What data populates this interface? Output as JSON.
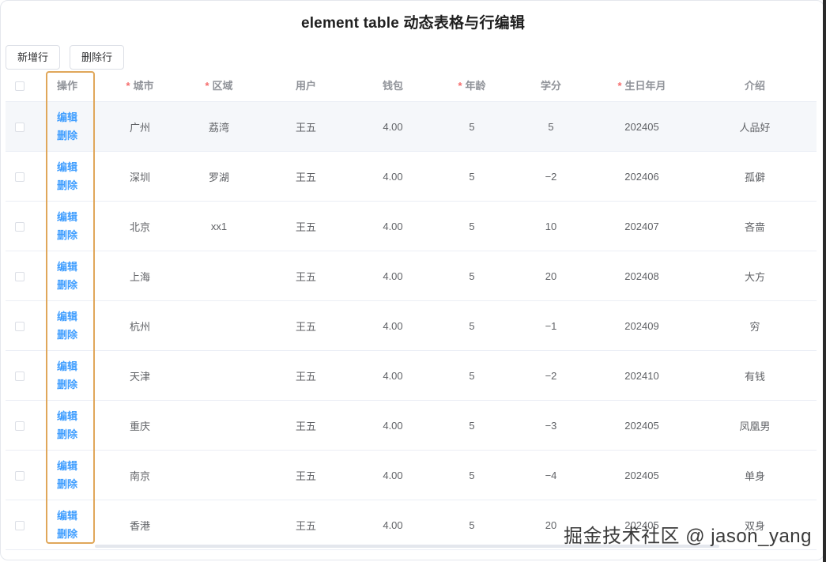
{
  "title": "element table 动态表格与行编辑",
  "toolbar": {
    "add_label": "新增行",
    "delete_label": "删除行"
  },
  "columns": {
    "op": "操作",
    "city": "城市",
    "area": "区域",
    "user": "用户",
    "wallet": "钱包",
    "age": "年龄",
    "credit": "学分",
    "birth": "生日年月",
    "intro": "介绍",
    "required_mark": "*"
  },
  "row_actions": {
    "edit": "编辑",
    "delete": "删除"
  },
  "rows": [
    {
      "city": "广州",
      "area": "荔湾",
      "user": "王五",
      "wallet": "4.00",
      "age": "5",
      "credit": "5",
      "birth": "202405",
      "intro": "人品好"
    },
    {
      "city": "深圳",
      "area": "罗湖",
      "user": "王五",
      "wallet": "4.00",
      "age": "5",
      "credit": "−2",
      "birth": "202406",
      "intro": "孤僻"
    },
    {
      "city": "北京",
      "area": "xx1",
      "user": "王五",
      "wallet": "4.00",
      "age": "5",
      "credit": "10",
      "birth": "202407",
      "intro": "吝啬"
    },
    {
      "city": "上海",
      "area": "",
      "user": "王五",
      "wallet": "4.00",
      "age": "5",
      "credit": "20",
      "birth": "202408",
      "intro": "大方"
    },
    {
      "city": "杭州",
      "area": "",
      "user": "王五",
      "wallet": "4.00",
      "age": "5",
      "credit": "−1",
      "birth": "202409",
      "intro": "穷"
    },
    {
      "city": "天津",
      "area": "",
      "user": "王五",
      "wallet": "4.00",
      "age": "5",
      "credit": "−2",
      "birth": "202410",
      "intro": "有钱"
    },
    {
      "city": "重庆",
      "area": "",
      "user": "王五",
      "wallet": "4.00",
      "age": "5",
      "credit": "−3",
      "birth": "202405",
      "intro": "凤凰男"
    },
    {
      "city": "南京",
      "area": "",
      "user": "王五",
      "wallet": "4.00",
      "age": "5",
      "credit": "−4",
      "birth": "202405",
      "intro": "单身"
    },
    {
      "city": "香港",
      "area": "",
      "user": "王五",
      "wallet": "4.00",
      "age": "5",
      "credit": "20",
      "birth": "202405",
      "intro": "双身"
    }
  ],
  "watermark": "掘金技术社区 @ jason_yang",
  "colors": {
    "link": "#409eff",
    "required": "#f56c6c",
    "highlight_border": "#e0a75a",
    "row_hover": "#f5f7fa"
  }
}
